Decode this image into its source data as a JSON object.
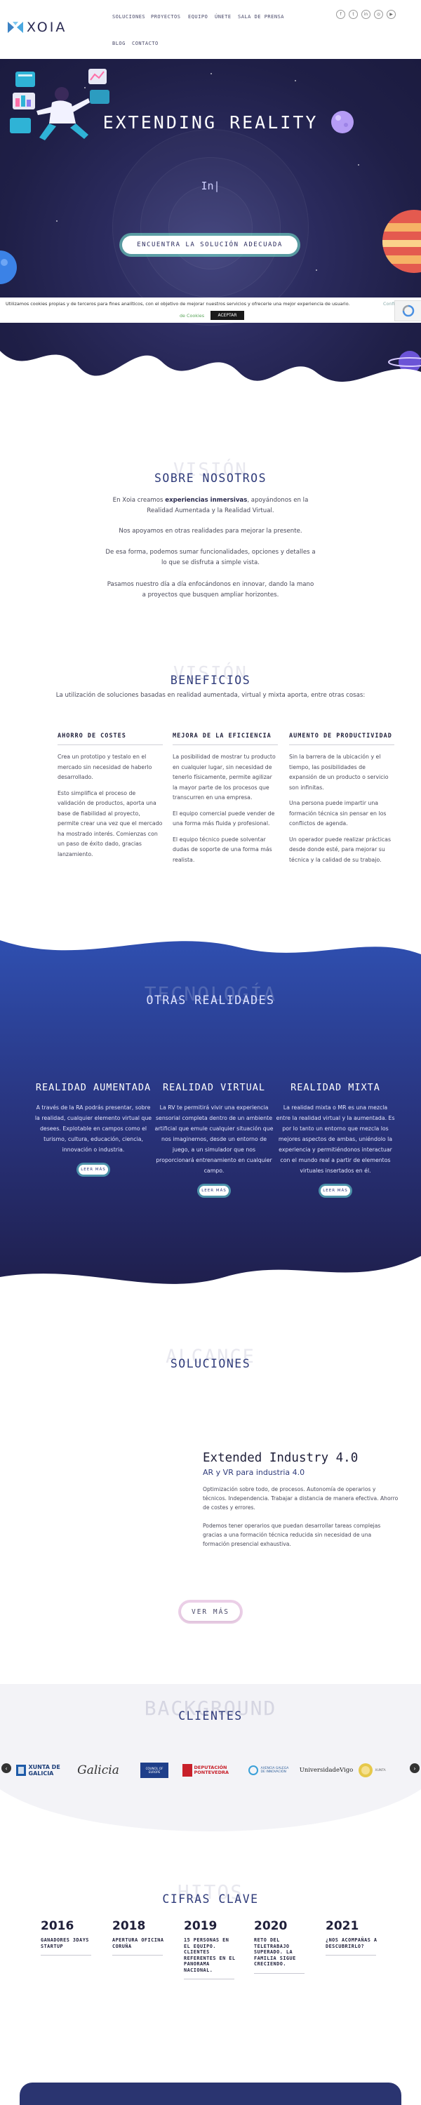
{
  "header": {
    "brand": "XOIA",
    "nav": [
      "SOLUCIONES",
      "PROYECTOS",
      "EQUIPO",
      "ÚNETE",
      "SALA DE PRENSA",
      "BLOG",
      "CONTACTO"
    ],
    "social_icons": [
      "facebook-icon",
      "twitter-icon",
      "linkedin-icon",
      "instagram-icon",
      "youtube-icon"
    ]
  },
  "hero": {
    "title": "EXTENDING REALITY",
    "typed": "In|",
    "cta": "ENCUENTRA LA SOLUCIÓN ADECUADA"
  },
  "cookie": {
    "text": "Utilizamos cookies propias y de terceros para fines analíticos, con el objetivo de mejorar nuestros servicios y ofrecerle una mejor experiencia de usuario.",
    "config": "Confi",
    "link": "de Cookies",
    "accept": "ACEPTAR"
  },
  "about": {
    "ghost": "VISIÓN",
    "title": "SOBRE NOSOTROS",
    "p1_pre": "En Xoia creamos ",
    "p1_bold": "experiencias inmersivas",
    "p1_post": ", apoyándonos en la Realidad Aumentada y la Realidad Virtual.",
    "p2": "Nos apoyamos en otras realidades para mejorar la presente.",
    "p3": "De esa forma, podemos sumar funcionalidades, opciones y detalles a lo que se disfruta a simple vista.",
    "p4": "Pasamos nuestro día a día enfocándonos en innovar, dando la mano a proyectos que busquen ampliar horizontes."
  },
  "benefits": {
    "ghost": "VISIÓN",
    "title": "BENEFICIOS",
    "subtitle": "La utilización de soluciones basadas en realidad aumentada, virtual y mixta aporta, entre otras cosas:",
    "cols": [
      {
        "heading": "AHORRO DE COSTES",
        "paras": [
          "Crea un prototipo y testalo en el mercado sin necesidad de haberlo desarrollado.",
          "Esto simplifica el proceso de validación de productos, aporta una base de fiabilidad al proyecto, permite crear una vez que el mercado ha mostrado interés. Comienzas con un paso de éxito dado, gracias lanzamiento."
        ]
      },
      {
        "heading": "MEJORA DE LA EFICIENCIA",
        "paras": [
          "La posibilidad de mostrar tu producto en cualquier lugar, sin necesidad de tenerlo físicamente, permite agilizar la mayor parte de los procesos que transcurren en una empresa.",
          "El equipo comercial puede vender de una forma más fluida y profesional.",
          "El equipo técnico puede solventar dudas de soporte de una forma más realista."
        ]
      },
      {
        "heading": "AUMENTO DE PRODUCTIVIDAD",
        "paras": [
          "Sin la barrera de la ubicación y el tiempo, las posibilidades de expansión de un producto o servicio son infinitas.",
          "Una persona puede impartir una formación técnica sin pensar en los conflictos de agenda.",
          "Un operador puede realizar prácticas desde donde esté, para mejorar su técnica y la calidad de su trabajo."
        ]
      }
    ]
  },
  "tech": {
    "ghost": "TECNOLOGÍA",
    "title": "OTRAS REALIDADES",
    "cols": [
      {
        "heading": "REALIDAD AUMENTADA",
        "text": "A través de la RA podrás presentar, sobre la realidad, cualquier elemento virtual que desees. Explotable en campos como el turismo, cultura, educación, ciencia, innovación o industria.",
        "btn": "LEER MÁS"
      },
      {
        "heading": "REALIDAD VIRTUAL",
        "text": "La RV te permitirá vivir una experiencia sensorial completa dentro de un ambiente artificial que emule cualquier situación que nos imaginemos, desde un entorno de juego, a un simulador que nos proporcionará entrenamiento en cualquier campo.",
        "btn": "LEER MÁS"
      },
      {
        "heading": "REALIDAD MIXTA",
        "text": "La realidad mixta o MR es una mezcla entre la realidad virtual y la aumentada. Es por lo tanto un entorno que mezcla los mejores aspectos de ambas, uniéndolo la experiencia y permitiéndonos interactuar con el mundo real a partir de elementos virtuales insertados en él.",
        "btn": "LEER MÁS"
      }
    ]
  },
  "solutions": {
    "ghost": "ALCANCE",
    "title": "SOLUCIONES",
    "item_title": "Extended Industry 4.0",
    "item_subtitle": "AR y VR para industria 4.0",
    "p1": "Optimización sobre todo, de procesos. Autonomía de operarios y técnicos. Independencia. Trabajar a distancia de manera efectiva. Ahorro de costes y errores.",
    "p2": "Podemos tener operarios que puedan desarrollar tareas complejas gracias a una formación técnica reducida sin necesidad de una formación presencial exhaustiva.",
    "btn": "VER MÁS"
  },
  "clients": {
    "ghost": "BACKGROUND",
    "title": "CLIENTES",
    "logos": [
      "XUNTA DE GALICIA",
      "Galicia",
      "COUNCIL OF EUROPE",
      "DEPUTACIÓN PONTEVEDRA",
      "AXENCIA GALEGA DE INNOVACIÓN",
      "UniversidadeVigo",
      "XUNTA"
    ]
  },
  "milestones": {
    "ghost": "HITOS",
    "title": "CIFRAS CLAVE",
    "items": [
      {
        "year": "2016",
        "text": "GANADORES 3DAYS STARTUP"
      },
      {
        "year": "2018",
        "text": "APERTURA OFICINA CORUÑA"
      },
      {
        "year": "2019",
        "text": "15 PERSONAS EN EL EQUIPO. CLIENTES REFERENTES EN EL PANORAMA NACIONAL."
      },
      {
        "year": "2020",
        "text": "RETO DEL TELETRABAJO SUPERADO. LA FAMILIA SIGUE CRECIENDO."
      },
      {
        "year": "2021",
        "text": "¿NOS ACOMPAÑAS A DESCUBRIRLO?"
      }
    ]
  },
  "colors": {
    "navy": "#2b2b5e",
    "accent_blue": "#2f3b7a",
    "mint": "#78f0d2"
  }
}
